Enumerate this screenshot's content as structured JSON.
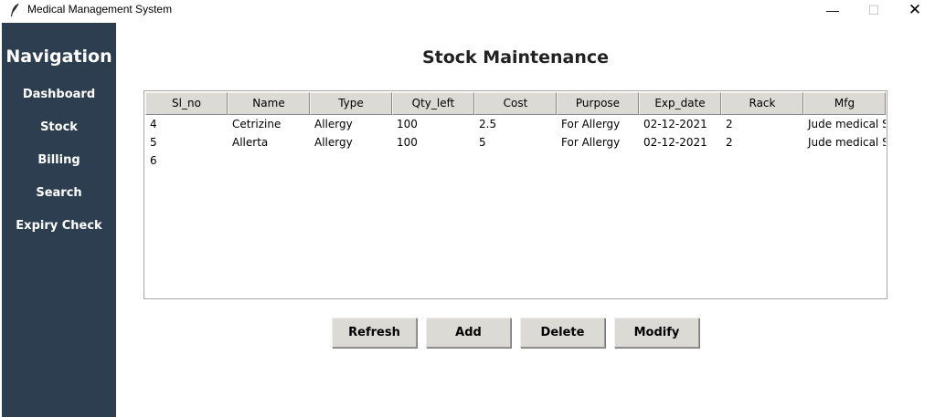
{
  "window": {
    "title": "Medical Management System",
    "minimize_glyph": "—",
    "maximize_glyph": "☐",
    "close_glyph": "✕"
  },
  "sidebar": {
    "heading": "Navigation",
    "items": [
      {
        "label": "Dashboard"
      },
      {
        "label": "Stock"
      },
      {
        "label": "Billing"
      },
      {
        "label": "Search"
      },
      {
        "label": "Expiry Check"
      }
    ],
    "background_color": "#2c3e50"
  },
  "main": {
    "title": "Stock Maintenance",
    "table": {
      "columns": [
        "Sl_no",
        "Name",
        "Type",
        "Qty_left",
        "Cost",
        "Purpose",
        "Exp_date",
        "Rack",
        "Mfg"
      ],
      "rows": [
        [
          "4",
          "Cetrizine",
          "Allergy",
          "100",
          "2.5",
          "For Allergy",
          "02-12-2021",
          "2",
          "Jude medical Sh"
        ],
        [
          "5",
          "Allerta",
          "Allergy",
          "100",
          "5",
          "For Allergy",
          "02-12-2021",
          "2",
          "Jude medical Sh"
        ],
        [
          "6",
          "",
          "",
          "",
          "",
          "",
          "",
          "",
          ""
        ]
      ]
    },
    "buttons": {
      "refresh": "Refresh",
      "add": "Add",
      "delete": "Delete",
      "modify": "Modify"
    }
  },
  "icons": {
    "app": "feather-icon"
  }
}
